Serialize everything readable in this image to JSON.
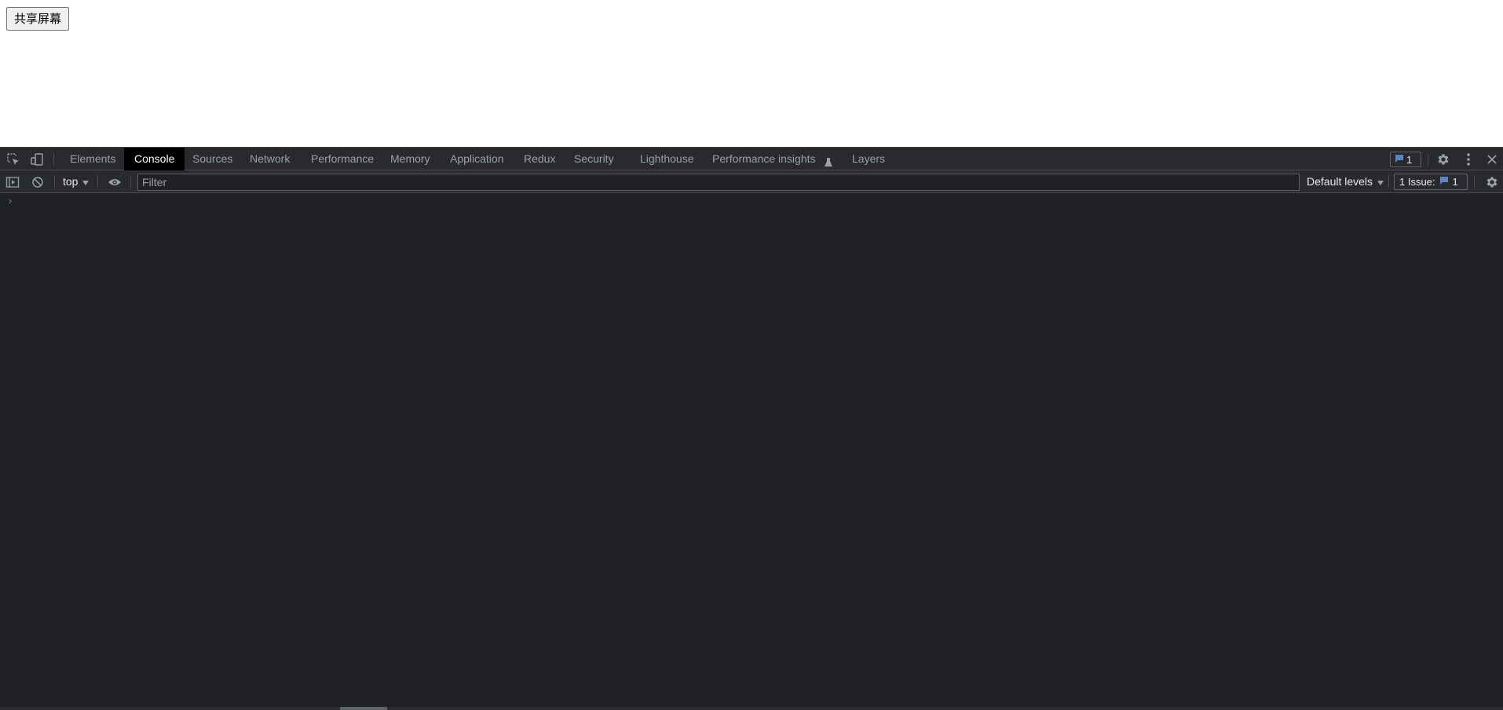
{
  "page": {
    "share_button_label": "共享屏幕"
  },
  "devtools": {
    "tabs": [
      {
        "label": "Elements"
      },
      {
        "label": "Console"
      },
      {
        "label": "Sources"
      },
      {
        "label": "Network"
      },
      {
        "label": "Performance"
      },
      {
        "label": "Memory"
      },
      {
        "label": "Application"
      },
      {
        "label": "Redux"
      },
      {
        "label": "Security"
      },
      {
        "label": "Lighthouse"
      },
      {
        "label": "Performance insights"
      },
      {
        "label": "Layers"
      }
    ],
    "active_tab": "Console",
    "message_count": "1",
    "icons": {
      "inspect": "inspect-element-icon",
      "device": "device-toolbar-icon",
      "flask": "experiment-flask-icon",
      "message": "message-bubble-icon",
      "settings": "gear-icon",
      "menu": "more-vertical-icon",
      "close": "close-icon",
      "sidebar": "sidebar-toggle-icon",
      "clear": "clear-console-icon",
      "eye": "live-expression-eye-icon",
      "dropdown": "dropdown-triangle-icon"
    },
    "console_toolbar": {
      "context": "top",
      "filter_placeholder": "Filter",
      "levels_label": "Default levels",
      "issues_label": "1 Issue:",
      "issues_count": "1"
    },
    "console": {
      "prompt": "›"
    },
    "colors": {
      "background": "#202124",
      "toolbar": "#292a2d",
      "active_tab": "#000000",
      "accent": "#5a86c6"
    }
  }
}
